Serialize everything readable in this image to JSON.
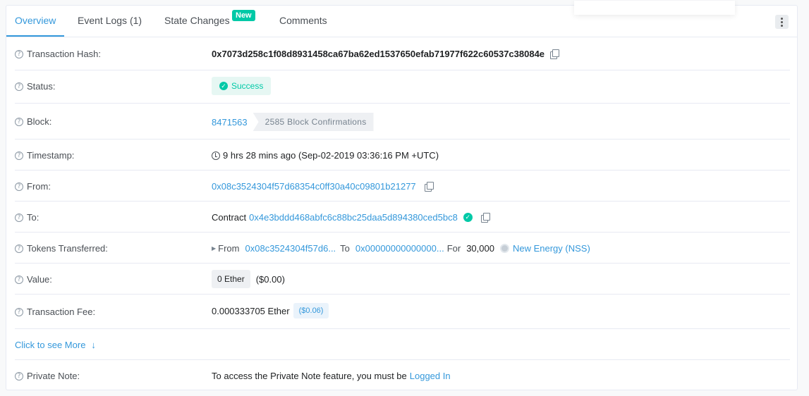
{
  "tabs": {
    "overview": "Overview",
    "event_logs": "Event Logs (1)",
    "state_changes": "State Changes",
    "new_badge": "New",
    "comments": "Comments"
  },
  "rows": {
    "tx_hash": {
      "label": "Transaction Hash:",
      "value": "0x7073d258c1f08d8931458ca67ba62ed1537650efab71977f622c60537c38084e"
    },
    "status": {
      "label": "Status:",
      "value": "Success"
    },
    "block": {
      "label": "Block:",
      "number": "8471563",
      "confirmations": "2585 Block Confirmations"
    },
    "timestamp": {
      "label": "Timestamp:",
      "value": "9 hrs 28 mins ago (Sep-02-2019 03:36:16 PM +UTC)"
    },
    "from": {
      "label": "From:",
      "address": "0x08c3524304f57d68354c0ff30a40c09801b21277"
    },
    "to": {
      "label": "To:",
      "prefix": "Contract",
      "address": "0x4e3bddd468abfc6c88bc25daa5d894380ced5bc8"
    },
    "tokens": {
      "label": "Tokens Transferred:",
      "from_label": "From",
      "from_addr": "0x08c3524304f57d6...",
      "to_label": "To",
      "to_addr": "0x00000000000000...",
      "for_label": "For",
      "amount": "30,000",
      "token_name": "New Energy (NSS)"
    },
    "value": {
      "label": "Value:",
      "ether": "0 Ether",
      "usd": "($0.00)"
    },
    "fee": {
      "label": "Transaction Fee:",
      "ether": "0.000333705 Ether",
      "usd": "($0.06)"
    },
    "see_more": "Click to see More",
    "private_note": {
      "label": "Private Note:",
      "text": "To access the Private Note feature, you must be",
      "link": "Logged In"
    }
  },
  "colors": {
    "accent": "#3498db",
    "success": "#00c9a7"
  }
}
